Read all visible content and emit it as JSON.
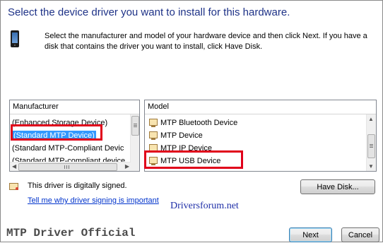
{
  "header": {
    "title": "Select the device driver you want to install for this hardware.",
    "description": "Select the manufacturer and model of your hardware device and then click Next. If you have a disk that contains the driver you want to install, click Have Disk."
  },
  "manufacturer_panel": {
    "header": "Manufacturer",
    "items": [
      {
        "label": "(Enhanced Storage Device)"
      },
      {
        "label": "(Standard MTP Device)"
      },
      {
        "label": "(Standard MTP-Compliant Devic"
      },
      {
        "label": "(Standard MTP-compliant device"
      }
    ],
    "selected": "(Standard MTP Device)"
  },
  "model_panel": {
    "header": "Model",
    "items": [
      {
        "label": "MTP Bluetooth Device"
      },
      {
        "label": "MTP Device"
      },
      {
        "label": "MTP IP Device"
      },
      {
        "label": "MTP USB Device"
      }
    ]
  },
  "signature": {
    "status": "This driver is digitally signed.",
    "link": "Tell me why driver signing is important"
  },
  "buttons": {
    "have_disk": "Have Disk...",
    "next": "Next",
    "cancel": "Cancel"
  },
  "watermark": "Driversforum.net",
  "footer_caption": "MTP Driver Official",
  "colors": {
    "title": "#1e3287",
    "highlight_box": "#e0001a",
    "selection": "#3399ff",
    "link": "#0033cc"
  }
}
